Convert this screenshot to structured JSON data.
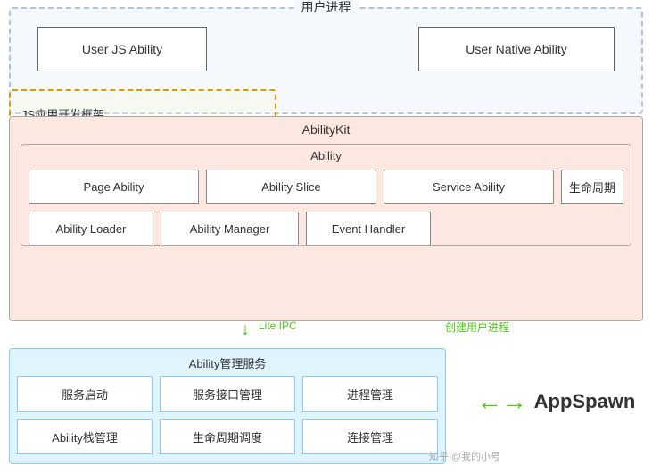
{
  "user_process": {
    "label": "用户进程",
    "user_js_ability": "User JS Ability",
    "user_native_ability": "User Native Ability"
  },
  "js_framework": {
    "label": "JS应用开发框架"
  },
  "abilitykit": {
    "label": "AbilityKit",
    "ability": {
      "label": "Ability",
      "row1": [
        {
          "text": "Page Ability"
        },
        {
          "text": "Ability Slice"
        },
        {
          "text": "Service Ability"
        },
        {
          "text": "生命周期"
        }
      ],
      "row2": [
        {
          "text": "Ability Loader"
        },
        {
          "text": "Ability Manager"
        },
        {
          "text": "Event Handler"
        }
      ]
    }
  },
  "lite_ipc": {
    "label": "Lite IPC",
    "arrow": "↓"
  },
  "create_process": {
    "label": "创建用户进程"
  },
  "ability_mgmt": {
    "label": "Ability管理服务",
    "row1": [
      {
        "text": "服务启动"
      },
      {
        "text": "服务接口管理"
      },
      {
        "text": "进程管理"
      }
    ],
    "row2": [
      {
        "text": "Ability栈管理"
      },
      {
        "text": "生命周期调度"
      },
      {
        "text": "连接管理"
      }
    ]
  },
  "appspawn": {
    "arrow": "←→",
    "label": "AppSpawn"
  },
  "watermark": {
    "text1": "知乎 @我的小号",
    "text2": ""
  }
}
